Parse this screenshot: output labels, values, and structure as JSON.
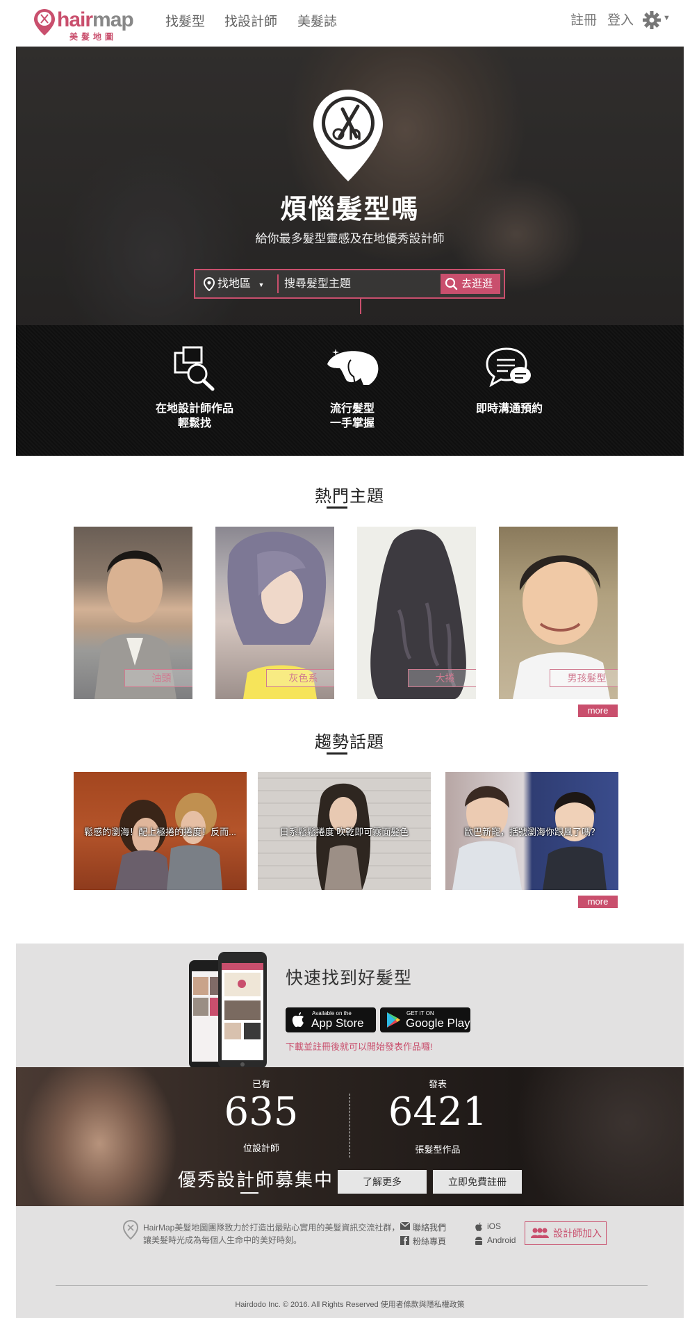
{
  "brand": {
    "name_en_hair": "hair",
    "name_en_map": "map",
    "name_zh": "美髮地圖",
    "color": "#c94f6d"
  },
  "nav": {
    "links": [
      "找髮型",
      "找設計師",
      "美髮誌"
    ],
    "register": "註冊",
    "login": "登入"
  },
  "hero": {
    "title": "煩惱髮型嗎",
    "subtitle": "給你最多髮型靈感及在地優秀設計師",
    "region_label": "找地區",
    "search_placeholder": "搜尋髮型主題",
    "search_button": "去逛逛"
  },
  "features": [
    {
      "icon": "photo-search-icon",
      "line1": "在地設計師作品",
      "line2": "輕鬆找"
    },
    {
      "icon": "hairstyle-head-icon",
      "line1": "流行髮型",
      "line2": "一手掌握"
    },
    {
      "icon": "chat-bubbles-icon",
      "line1": "即時溝通預約",
      "line2": ""
    }
  ],
  "hot_topics": {
    "title": "熱門主題",
    "items": [
      "油頭",
      "灰色系",
      "大捲",
      "男孩髮型"
    ],
    "more": "more"
  },
  "trending": {
    "title": "趨勢話題",
    "items": [
      "鬆感的瀏海！配上極捲的捲度！反而...",
      "日系鬆鬆捲度 吹乾即可霧面髮色",
      "歐巴新寵，括號瀏海你跟風了嗎？"
    ],
    "more": "more"
  },
  "app": {
    "title": "快速找到好髮型",
    "appstore_small": "Available on the",
    "appstore_big": "App Store",
    "googleplay_small": "GET IT ON",
    "googleplay_big": "Google Play",
    "note": "下載並註冊後就可以開始發表作品囉!"
  },
  "stats": {
    "designers_prefix": "已有",
    "designers_count": "635",
    "designers_suffix": "位設計師",
    "works_prefix": "發表",
    "works_count": "6421",
    "works_suffix": "張髮型作品",
    "recruit": "優秀設計師募集中",
    "learn_more": "了解更多",
    "register_free": "立即免費註冊"
  },
  "footer": {
    "about": "HairMap美髮地圖團隊致力於打造出最貼心實用的美髮資訊交流社群，讓美髮時光成為每個人生命中的美好時刻。",
    "contact": "聯絡我們",
    "fanpage": "粉絲專頁",
    "ios": "iOS",
    "android": "Android",
    "designer_join": "設計師加入",
    "copyright": "Hairdodo Inc. © 2016. All Rights Reserved 使用者條款與隱私權政策"
  }
}
